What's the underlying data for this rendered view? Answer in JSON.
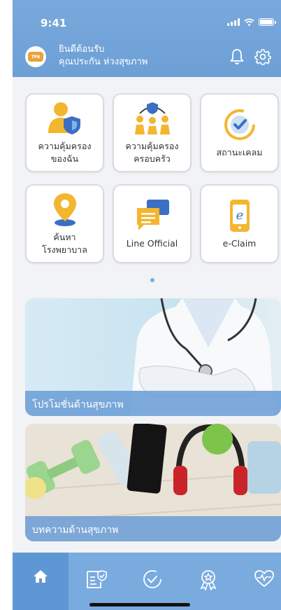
{
  "status_bar": {
    "time": "9:41"
  },
  "header": {
    "logo_text": "TPA",
    "welcome_line1": "ยินดีต้อนรับ",
    "welcome_line2": "คุณประกัน ห่วงสุขภาพ",
    "bell_icon": "bell-icon",
    "settings_icon": "gear-icon"
  },
  "menu": [
    {
      "label": "ความคุ้มครอง\nของฉัน",
      "icon": "person-shield-icon"
    },
    {
      "label": "ความคุ้มครอง\nครอบครัว",
      "icon": "family-shield-icon"
    },
    {
      "label": "สถานะเคลม",
      "icon": "check-circle-icon"
    },
    {
      "label": "ค้นหา\nโรงพยาบาล",
      "icon": "location-pin-icon"
    },
    {
      "label": "Line Official",
      "icon": "chat-bubbles-icon"
    },
    {
      "label": "e-Claim",
      "icon": "phone-e-icon"
    }
  ],
  "banners": [
    {
      "caption": "โปรโมชั่นด้านสุขภาพ",
      "image": "doctor-stethoscope"
    },
    {
      "caption": "บทความด้านสุขภาพ",
      "image": "fitness-items"
    }
  ],
  "nav": {
    "active": "home",
    "items": [
      "home-icon",
      "document-check-icon",
      "progress-check-icon",
      "award-icon",
      "heart-pulse-icon"
    ]
  },
  "colors": {
    "header": "#6d9fd6",
    "nav": "#7aabdf",
    "nav_active": "#5f97d5",
    "accent_yellow": "#f3b62f"
  }
}
